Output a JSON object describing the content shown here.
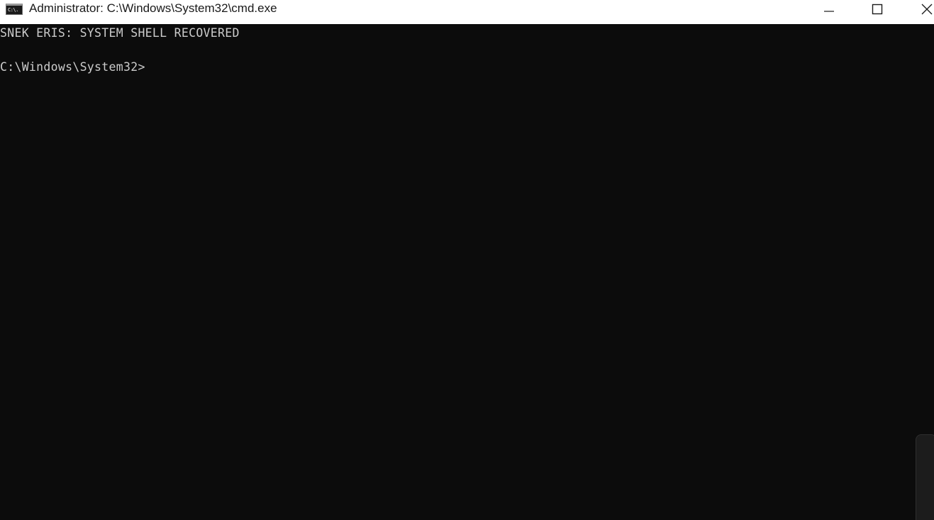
{
  "window": {
    "title": "Administrator: C:\\Windows\\System32\\cmd.exe",
    "app_icon_text": "C:\\."
  },
  "caption_buttons": {
    "minimize_icon": "minimize-icon",
    "maximize_icon": "maximize-icon",
    "close_icon": "close-icon"
  },
  "terminal": {
    "lines": [
      "SNEK ERIS: SYSTEM SHELL RECOVERED",
      "C:\\Windows\\System32>"
    ],
    "background_color": "#0c0c0c",
    "text_color": "#cccccc"
  }
}
